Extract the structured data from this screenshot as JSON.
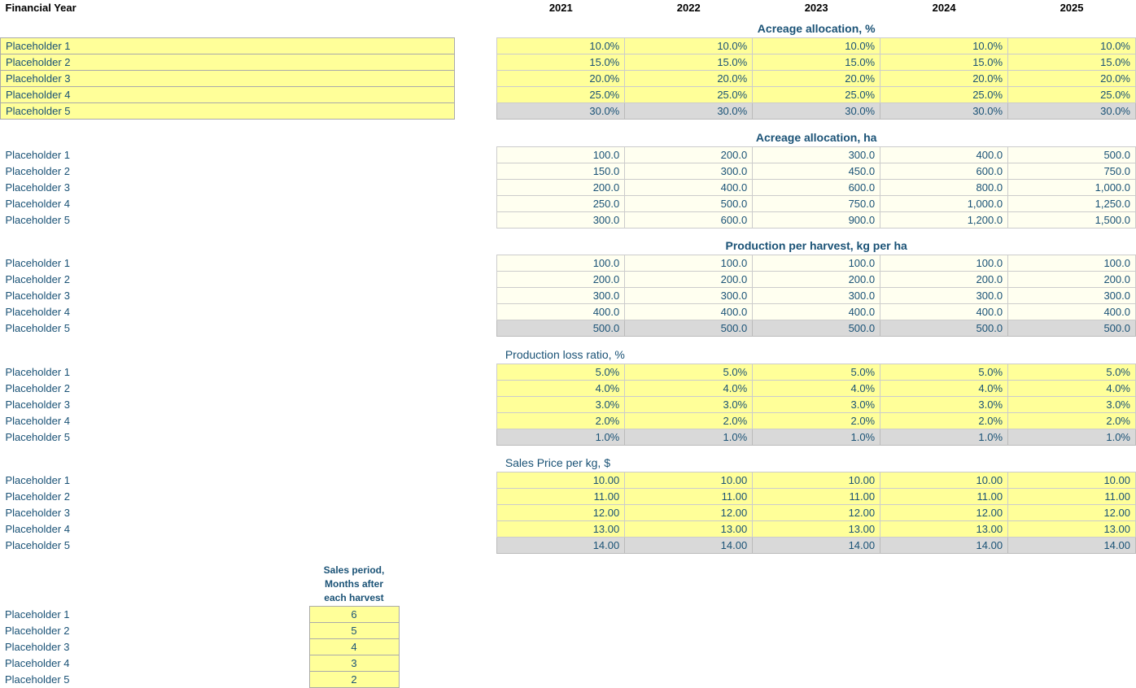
{
  "header": {
    "financial_year_label": "Financial Year",
    "years": [
      "2021",
      "2022",
      "2023",
      "2024",
      "2025"
    ]
  },
  "sections": [
    {
      "id": "acreage_pct",
      "title": "Acreage allocation, %",
      "style": "yellow",
      "rows": [
        {
          "label": "Placeholder 1",
          "values": [
            "10.0%",
            "10.0%",
            "10.0%",
            "10.0%",
            "10.0%"
          ]
        },
        {
          "label": "Placeholder 2",
          "values": [
            "15.0%",
            "15.0%",
            "15.0%",
            "15.0%",
            "15.0%"
          ]
        },
        {
          "label": "Placeholder 3",
          "values": [
            "20.0%",
            "20.0%",
            "20.0%",
            "20.0%",
            "20.0%"
          ]
        },
        {
          "label": "Placeholder 4",
          "values": [
            "25.0%",
            "25.0%",
            "25.0%",
            "25.0%",
            "25.0%"
          ]
        },
        {
          "label": "Placeholder 5",
          "values": [
            "30.0%",
            "30.0%",
            "30.0%",
            "30.0%",
            "30.0%"
          ]
        }
      ]
    },
    {
      "id": "acreage_ha",
      "title": "Acreage allocation, ha",
      "style": "lightyellow",
      "rows": [
        {
          "label": "Placeholder 1",
          "values": [
            "100.0",
            "200.0",
            "300.0",
            "400.0",
            "500.0"
          ]
        },
        {
          "label": "Placeholder 2",
          "values": [
            "150.0",
            "300.0",
            "450.0",
            "600.0",
            "750.0"
          ]
        },
        {
          "label": "Placeholder 3",
          "values": [
            "200.0",
            "400.0",
            "600.0",
            "800.0",
            "1,000.0"
          ]
        },
        {
          "label": "Placeholder 4",
          "values": [
            "250.0",
            "500.0",
            "750.0",
            "1,000.0",
            "1,250.0"
          ]
        },
        {
          "label": "Placeholder 5",
          "values": [
            "300.0",
            "600.0",
            "900.0",
            "1,200.0",
            "1,500.0"
          ]
        }
      ]
    },
    {
      "id": "production_harvest",
      "title": "Production per harvest, kg per ha",
      "style": "lightyellow",
      "rows": [
        {
          "label": "Placeholder 1",
          "values": [
            "100.0",
            "100.0",
            "100.0",
            "100.0",
            "100.0"
          ]
        },
        {
          "label": "Placeholder 2",
          "values": [
            "200.0",
            "200.0",
            "200.0",
            "200.0",
            "200.0"
          ]
        },
        {
          "label": "Placeholder 3",
          "values": [
            "300.0",
            "300.0",
            "300.0",
            "300.0",
            "300.0"
          ]
        },
        {
          "label": "Placeholder 4",
          "values": [
            "400.0",
            "400.0",
            "400.0",
            "400.0",
            "400.0"
          ]
        },
        {
          "label": "Placeholder 5",
          "values": [
            "500.0",
            "500.0",
            "500.0",
            "500.0",
            "500.0"
          ]
        }
      ]
    },
    {
      "id": "production_loss",
      "title": "Production loss ratio, %",
      "style": "yellow",
      "rows": [
        {
          "label": "Placeholder 1",
          "values": [
            "5.0%",
            "5.0%",
            "5.0%",
            "5.0%",
            "5.0%"
          ]
        },
        {
          "label": "Placeholder 2",
          "values": [
            "4.0%",
            "4.0%",
            "4.0%",
            "4.0%",
            "4.0%"
          ]
        },
        {
          "label": "Placeholder 3",
          "values": [
            "3.0%",
            "3.0%",
            "3.0%",
            "3.0%",
            "3.0%"
          ]
        },
        {
          "label": "Placeholder 4",
          "values": [
            "2.0%",
            "2.0%",
            "2.0%",
            "2.0%",
            "2.0%"
          ]
        },
        {
          "label": "Placeholder 5",
          "values": [
            "1.0%",
            "1.0%",
            "1.0%",
            "1.0%",
            "1.0%"
          ]
        }
      ]
    },
    {
      "id": "sales_price",
      "title": "Sales Price per kg, $",
      "style": "yellow",
      "rows": [
        {
          "label": "Placeholder 1",
          "values": [
            "10.00",
            "10.00",
            "10.00",
            "10.00",
            "10.00"
          ]
        },
        {
          "label": "Placeholder 2",
          "values": [
            "11.00",
            "11.00",
            "11.00",
            "11.00",
            "11.00"
          ]
        },
        {
          "label": "Placeholder 3",
          "values": [
            "12.00",
            "12.00",
            "12.00",
            "12.00",
            "12.00"
          ]
        },
        {
          "label": "Placeholder 4",
          "values": [
            "13.00",
            "13.00",
            "13.00",
            "13.00",
            "13.00"
          ]
        },
        {
          "label": "Placeholder 5",
          "values": [
            "14.00",
            "14.00",
            "14.00",
            "14.00",
            "14.00"
          ]
        }
      ]
    }
  ],
  "sales_period": {
    "title": "Sales period,\nMonths after\neach harvest",
    "rows": [
      {
        "label": "Placeholder 1",
        "value": "6"
      },
      {
        "label": "Placeholder 2",
        "value": "5"
      },
      {
        "label": "Placeholder 3",
        "value": "4"
      },
      {
        "label": "Placeholder 4",
        "value": "3"
      },
      {
        "label": "Placeholder 5",
        "value": "2"
      }
    ]
  }
}
